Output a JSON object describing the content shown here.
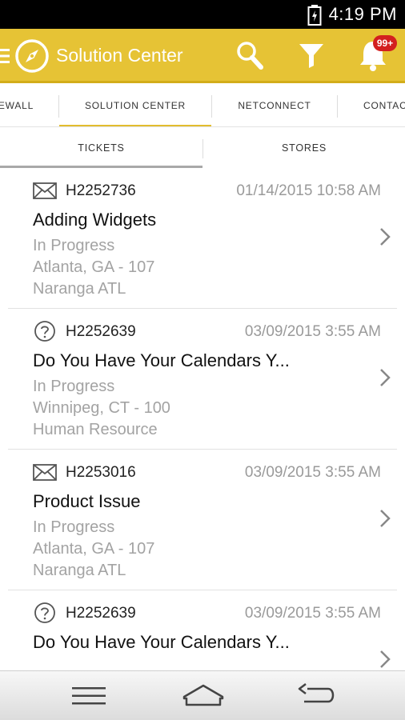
{
  "status_bar": {
    "time": "4:19 PM"
  },
  "app_bar": {
    "title": "Solution Center",
    "notification_badge": "99+",
    "accent_color": "#e6c335"
  },
  "top_tabs": [
    {
      "label": "EWALL"
    },
    {
      "label": "SOLUTION CENTER"
    },
    {
      "label": "NETCONNECT"
    },
    {
      "label": "CONTAC"
    }
  ],
  "sub_tabs": [
    {
      "label": "TICKETS"
    },
    {
      "label": "STORES"
    }
  ],
  "tickets": [
    {
      "type_icon": "envelope-icon",
      "id": "H2252736",
      "date": "01/14/2015 10:58 AM",
      "title": "Adding Widgets",
      "status": "In Progress",
      "location": "Atlanta, GA - 107",
      "department": "Naranga ATL"
    },
    {
      "type_icon": "question-icon",
      "id": "H2252639",
      "date": "03/09/2015 3:55 AM",
      "title": "Do You Have Your Calendars Y...",
      "status": "In Progress",
      "location": "Winnipeg, CT - 100",
      "department": "Human Resource"
    },
    {
      "type_icon": "envelope-icon",
      "id": "H2253016",
      "date": "03/09/2015 3:55 AM",
      "title": "Product Issue",
      "status": "In Progress",
      "location": "Atlanta, GA - 107",
      "department": "Naranga ATL"
    },
    {
      "type_icon": "question-icon",
      "id": "H2252639",
      "date": "03/09/2015 3:55 AM",
      "title": "Do You Have Your Calendars Y...",
      "status": "",
      "location": "",
      "department": ""
    }
  ]
}
